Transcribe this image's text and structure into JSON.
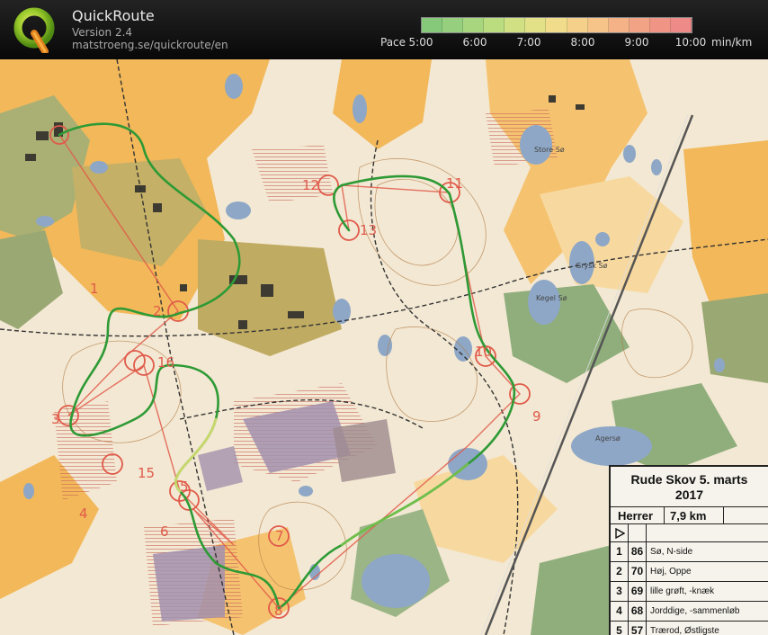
{
  "app": {
    "title": "QuickRoute",
    "version": "Version 2.4",
    "url": "matstroeng.se/quickroute/en",
    "logo_letter": "Q"
  },
  "pace": {
    "label": "Pace",
    "ticks": [
      "5:00",
      "6:00",
      "7:00",
      "8:00",
      "9:00",
      "10:00"
    ],
    "unit": "min/km",
    "gradient": [
      "#86c97a",
      "#96d07e",
      "#a8d67f",
      "#bcdc80",
      "#d0e083",
      "#e2e187",
      "#f0dc8a",
      "#f5d08a",
      "#f6c389",
      "#f4b286",
      "#f2a385",
      "#f09486",
      "#ee8a88"
    ]
  },
  "map": {
    "colors": {
      "forest_open": "#f3e8d3",
      "rough_open": "#f2b85a",
      "semi_open": "#f7d9a0",
      "green": "#7f9e6c",
      "urban": "#b6ad6a",
      "water": "#8ea7c6",
      "marsh": "#9a8aa8",
      "route": "#2e9a35",
      "course": "#e05a4a"
    },
    "lake_labels": [
      "Store Sø",
      "Kegel Sø",
      "Grysk Sø",
      "Agersø"
    ],
    "control_labels": [
      "1",
      "2",
      "3",
      "4",
      "5",
      "6",
      "7",
      "8",
      "9",
      "10",
      "11",
      "12",
      "13",
      "15",
      "16"
    ]
  },
  "legend": {
    "title_line1": "Rude Skov 5. marts",
    "title_line2": "2017",
    "class_name": "Herrer",
    "distance": "7,9 km",
    "rows": [
      {
        "num": "1",
        "code": "86",
        "desc": "Sø, N-side"
      },
      {
        "num": "2",
        "code": "70",
        "desc": "Høj, Oppe"
      },
      {
        "num": "3",
        "code": "69",
        "desc": "lille grøft, -knæk"
      },
      {
        "num": "4",
        "code": "68",
        "desc": "Jorddige, -sammenløb"
      },
      {
        "num": "5",
        "code": "57",
        "desc": "Trærod, Østligste"
      }
    ]
  }
}
